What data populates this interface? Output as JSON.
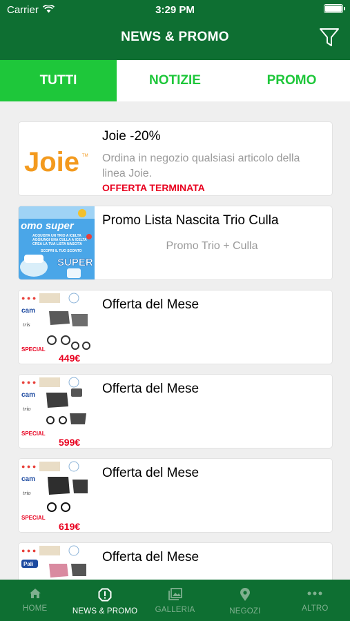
{
  "status_bar": {
    "carrier": "Carrier",
    "time": "3:29 PM"
  },
  "header": {
    "title": "NEWS & PROMO",
    "filter_icon": "filter-icon"
  },
  "tabs": [
    {
      "label": "TUTTI",
      "active": true
    },
    {
      "label": "NOTIZIE",
      "active": false
    },
    {
      "label": "PROMO",
      "active": false
    }
  ],
  "items": [
    {
      "title": "Joie -20%",
      "description": "Ordina in negozio qualsiasi articolo della linea Joie.",
      "status": "OFFERTA TERMINATA",
      "thumb_text": "Joie",
      "thumb_tm": "TM"
    },
    {
      "title": "Promo Lista Nascita Trio Culla",
      "description": "Promo Trio + Culla",
      "thumb_heading": "omo super",
      "thumb_lines": [
        "ACQUISTA UN TRIO A ICELTA",
        "AGGIUNGI UNA CULLA A ICELTA",
        "CREA LA TUA LISTA NASCITA",
        "SCOPRI IL TUO SCONTO"
      ],
      "thumb_tag": "SUPER"
    },
    {
      "title": "Offerta del Mese",
      "thumb_brand": "cam",
      "thumb_script": "tris",
      "thumb_price": "449€",
      "thumb_special": "SPECIAL"
    },
    {
      "title": "Offerta del Mese",
      "thumb_brand": "cam",
      "thumb_script": "trio",
      "thumb_price": "599€",
      "thumb_special": "SPECIAL"
    },
    {
      "title": "Offerta del Mese",
      "thumb_brand": "cam",
      "thumb_script": "trio",
      "thumb_price": "619€",
      "thumb_special": "SPECIAL"
    },
    {
      "title": "Offerta del Mese",
      "thumb_brand": "Pali",
      "thumb_script": "",
      "thumb_price": "",
      "thumb_special": ""
    }
  ],
  "bottom_nav": [
    {
      "label": "HOME",
      "icon": "home-icon",
      "active": false
    },
    {
      "label": "NEWS & PROMO",
      "icon": "alert-icon",
      "active": true
    },
    {
      "label": "GALLERIA",
      "icon": "gallery-icon",
      "active": false
    },
    {
      "label": "NEGOZI",
      "icon": "map-pin-icon",
      "active": false
    },
    {
      "label": "ALTRO",
      "icon": "more-icon",
      "active": false
    }
  ],
  "colors": {
    "primary_dark": "#0e6f32",
    "accent": "#1ec73a",
    "alert": "#e8001f",
    "joie_orange": "#f39a1e"
  }
}
